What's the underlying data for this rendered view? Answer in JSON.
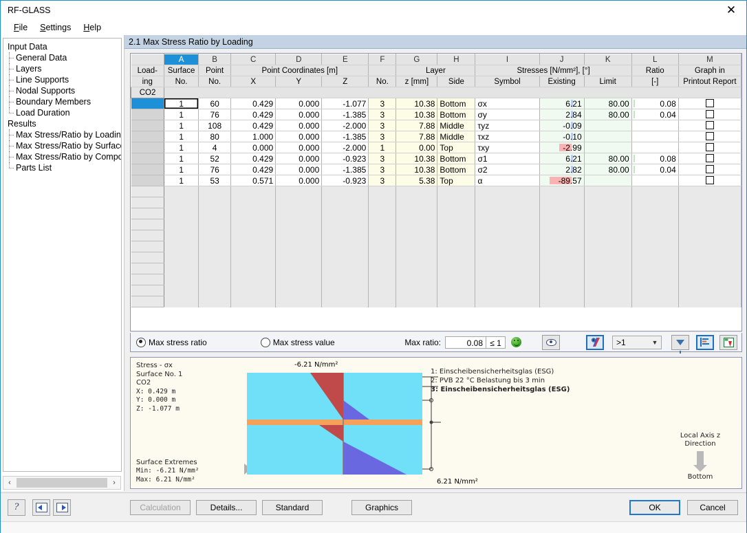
{
  "window": {
    "title": "RF-GLASS",
    "close_label": "✕"
  },
  "menu": [
    "File",
    "Settings",
    "Help"
  ],
  "sidebar": {
    "items": [
      {
        "label": "Input Data",
        "level": 0,
        "selected": false
      },
      {
        "label": "General Data",
        "level": 1,
        "selected": false
      },
      {
        "label": "Layers",
        "level": 1,
        "selected": false
      },
      {
        "label": "Line Supports",
        "level": 1,
        "selected": false
      },
      {
        "label": "Nodal Supports",
        "level": 1,
        "selected": false
      },
      {
        "label": "Boundary Members",
        "level": 1,
        "selected": false
      },
      {
        "label": "Load Duration",
        "level": 1,
        "selected": false
      },
      {
        "label": "Results",
        "level": 0,
        "selected": false
      },
      {
        "label": "Max Stress/Ratio by Loading",
        "level": 1,
        "selected": true
      },
      {
        "label": "Max Stress/Ratio by Surface",
        "level": 1,
        "selected": false
      },
      {
        "label": "Max Stress/Ratio by Compositio",
        "level": 1,
        "selected": false
      },
      {
        "label": "Parts List",
        "level": 1,
        "selected": false
      }
    ],
    "scroll_left": "‹",
    "scroll_right": "›"
  },
  "panel": {
    "title": "2.1 Max Stress Ratio by Loading"
  },
  "table": {
    "column_letters": [
      "A",
      "B",
      "C",
      "D",
      "E",
      "F",
      "G",
      "H",
      "I",
      "J",
      "K",
      "L",
      "M"
    ],
    "selected_letter": "A",
    "row_header_top": "Load-",
    "row_header_bottom": "ing",
    "group_headers": {
      "surface": "Surface",
      "point": "Point",
      "point_coordinates": "Point Coordinates [m]",
      "layer": "Layer",
      "stresses": "Stresses [N/mm²], [°]",
      "ratio": "Ratio",
      "graph_in": "Graph in"
    },
    "sub_headers": {
      "surface_no": "No.",
      "point_no": "No.",
      "x": "X",
      "y": "Y",
      "z": "Z",
      "layer_no": "No.",
      "layer_z": "z [mm]",
      "side": "Side",
      "symbol": "Symbol",
      "existing": "Existing",
      "limit": "Limit",
      "ratio_unit": "[-]",
      "printout_report": "Printout Report"
    },
    "group_label": "CO2",
    "rows": [
      {
        "active": true,
        "surface": "1",
        "point": "60",
        "x": "0.429",
        "y": "0.000",
        "z": "-1.077",
        "layer_no": "3",
        "layer_z": "10.38",
        "side": "Bottom",
        "symbol": "σx",
        "existing": "6.21",
        "bar": "blue",
        "limit": "80.00",
        "ratio": "0.08",
        "ratio_bar": "green",
        "graph": false
      },
      {
        "active": false,
        "surface": "1",
        "point": "76",
        "x": "0.429",
        "y": "0.000",
        "z": "-1.385",
        "layer_no": "3",
        "layer_z": "10.38",
        "side": "Bottom",
        "symbol": "σy",
        "existing": "2.84",
        "bar": "blue",
        "limit": "80.00",
        "ratio": "0.04",
        "ratio_bar": "green",
        "graph": false
      },
      {
        "active": false,
        "surface": "1",
        "point": "108",
        "x": "0.429",
        "y": "0.000",
        "z": "-2.000",
        "layer_no": "3",
        "layer_z": "7.88",
        "side": "Middle",
        "symbol": "τyz",
        "existing": "-0.09",
        "bar": "blue",
        "limit": "",
        "ratio": "",
        "ratio_bar": "",
        "graph": false
      },
      {
        "active": false,
        "surface": "1",
        "point": "80",
        "x": "1.000",
        "y": "0.000",
        "z": "-1.385",
        "layer_no": "3",
        "layer_z": "7.88",
        "side": "Middle",
        "symbol": "τxz",
        "existing": "-0.10",
        "bar": "blue",
        "limit": "",
        "ratio": "",
        "ratio_bar": "",
        "graph": false
      },
      {
        "active": false,
        "surface": "1",
        "point": "4",
        "x": "0.000",
        "y": "0.000",
        "z": "-2.000",
        "layer_no": "1",
        "layer_z": "0.00",
        "side": "Top",
        "symbol": "τxy",
        "existing": "-2.99",
        "bar": "red",
        "limit": "",
        "ratio": "",
        "ratio_bar": "",
        "graph": false
      },
      {
        "active": false,
        "surface": "1",
        "point": "52",
        "x": "0.429",
        "y": "0.000",
        "z": "-0.923",
        "layer_no": "3",
        "layer_z": "10.38",
        "side": "Bottom",
        "symbol": "σ1",
        "existing": "6.21",
        "bar": "blue",
        "limit": "80.00",
        "ratio": "0.08",
        "ratio_bar": "green",
        "graph": false
      },
      {
        "active": false,
        "surface": "1",
        "point": "76",
        "x": "0.429",
        "y": "0.000",
        "z": "-1.385",
        "layer_no": "3",
        "layer_z": "10.38",
        "side": "Bottom",
        "symbol": "σ2",
        "existing": "2.82",
        "bar": "blue",
        "limit": "80.00",
        "ratio": "0.04",
        "ratio_bar": "green",
        "graph": false
      },
      {
        "active": false,
        "surface": "1",
        "point": "53",
        "x": "0.571",
        "y": "0.000",
        "z": "-0.923",
        "layer_no": "3",
        "layer_z": "5.38",
        "side": "Top",
        "symbol": "α",
        "existing": "-89.57",
        "bar": "redwide",
        "limit": "",
        "ratio": "",
        "ratio_bar": "",
        "graph": false
      }
    ]
  },
  "options": {
    "radio_ratio": "Max stress ratio",
    "radio_value": "Max stress value",
    "radio_selected": "ratio",
    "max_ratio_label": "Max ratio:",
    "max_ratio_value": "0.08",
    "max_ratio_condition": "≤ 1",
    "smiley_icon": "smiley-ok-icon",
    "view_icon": "eye-icon",
    "colorbar_icon": "color-render-icon",
    "filter_combo_value": ">1",
    "filter_icon": "funnel-icon",
    "bars_icon": "bar-render-icon",
    "excel_icon": "export-excel-icon"
  },
  "graphics": {
    "stress_title": "Stress - σx",
    "surface_no": "Surface No. 1",
    "load_case": "CO2",
    "x_line": "X:  0.429 m",
    "y_line": "Y:  0.000 m",
    "z_line": "Z: -1.077 m",
    "extremes_title": "Surface Extremes",
    "min_line": "Min: -6.21 N/mm²",
    "max_line": "Max:  6.21 N/mm²",
    "label_top": "-6.21 N/mm²",
    "label_bottom": "6.21 N/mm²",
    "legend": [
      {
        "text": "1: Einscheibensicherheitsglas (ESG)",
        "bold": false
      },
      {
        "text": "2: PVB 22 °C Belastung bis 3 min",
        "bold": false
      },
      {
        "text": "3: Einscheibensicherheitsglas (ESG)",
        "bold": true
      }
    ],
    "axis_label_1": "Local Axis z",
    "axis_label_2": "Direction",
    "axis_label_3": "Bottom",
    "colors": {
      "glass": "#6fe0f7",
      "interlayer": "#f5a15a",
      "compression": "#c04a4a",
      "tension": "#6a68e0",
      "background": "#fdfbef"
    }
  },
  "footer": {
    "help_icon": "help-icon",
    "prev_icon": "previous-window-icon",
    "next_icon": "next-window-icon",
    "calculation": "Calculation",
    "details": "Details...",
    "standard": "Standard",
    "graphics": "Graphics",
    "ok": "OK",
    "cancel": "Cancel"
  }
}
